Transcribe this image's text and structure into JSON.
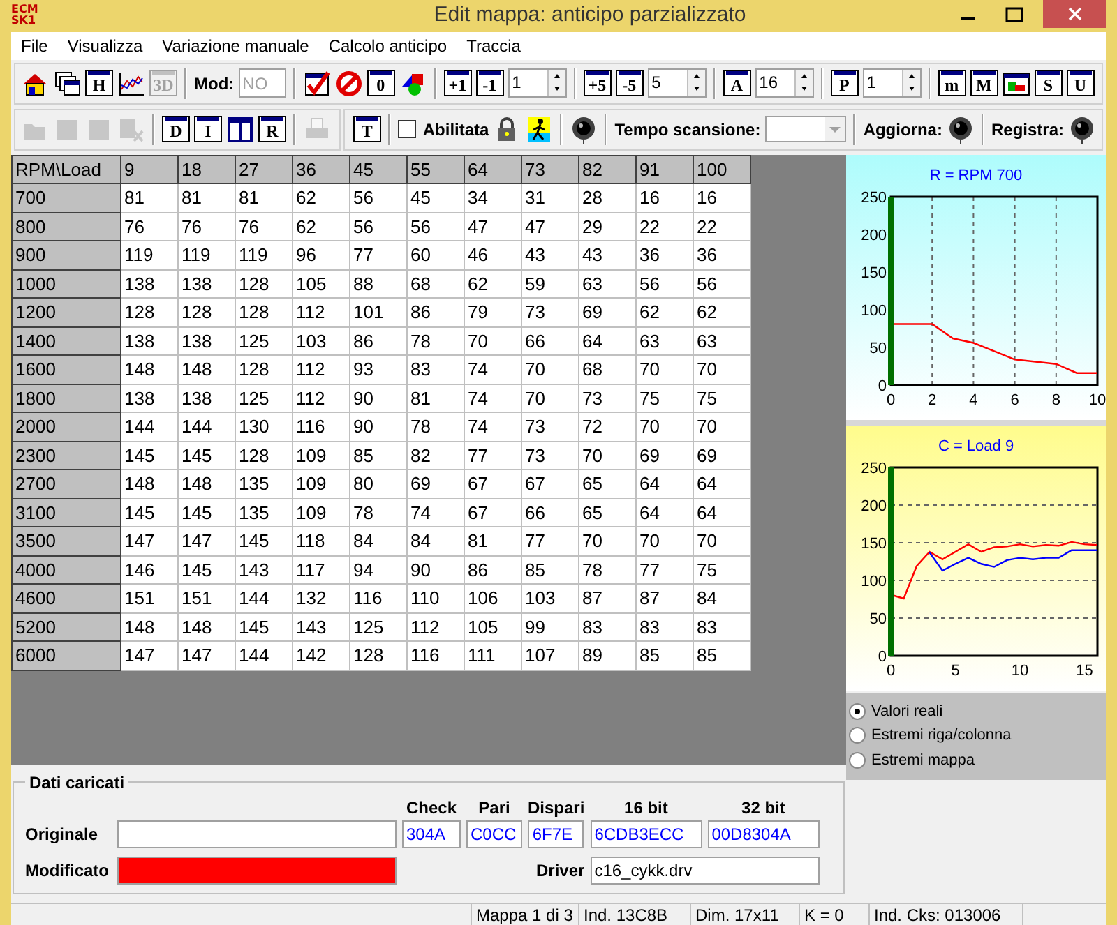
{
  "window": {
    "title": "Edit mappa: anticipo parzializzato",
    "logo": "ECM\nSK1"
  },
  "menu": [
    {
      "label": "File"
    },
    {
      "label": "Visualizza"
    },
    {
      "label": "Variazione manuale"
    },
    {
      "label": "Calcolo anticipo"
    },
    {
      "label": "Traccia"
    }
  ],
  "toolbar1": [
    {
      "kind": "icon",
      "disabled": false
    },
    {
      "kind": "icon",
      "disabled": false
    },
    {
      "kind": "glyph",
      "text": "H",
      "disabled": false
    },
    {
      "kind": "icon",
      "disabled": false
    },
    {
      "kind": "glyph",
      "text": "3D",
      "disabled": true
    },
    {
      "kind": "sep"
    },
    {
      "kind": "label",
      "text": "Mod:"
    },
    {
      "kind": "field",
      "value": "NO",
      "disabled": true
    },
    {
      "kind": "sep"
    },
    {
      "kind": "icon",
      "disabled": false
    },
    {
      "kind": "icon",
      "disabled": false
    },
    {
      "kind": "glyph",
      "text": "0",
      "disabled": false
    },
    {
      "kind": "icon",
      "disabled": false
    },
    {
      "kind": "sep"
    },
    {
      "kind": "glyph",
      "text": "+1",
      "disabled": false
    },
    {
      "kind": "glyph",
      "text": "-1",
      "disabled": false
    },
    {
      "kind": "spin",
      "value": "1"
    },
    {
      "kind": "sep"
    },
    {
      "kind": "glyph",
      "text": "+5",
      "disabled": false
    },
    {
      "kind": "glyph",
      "text": "-5",
      "disabled": false
    },
    {
      "kind": "spin",
      "value": "5"
    },
    {
      "kind": "sep"
    },
    {
      "kind": "glyph",
      "text": "A",
      "disabled": false
    },
    {
      "kind": "spin",
      "value": "16"
    },
    {
      "kind": "sep"
    },
    {
      "kind": "glyph",
      "text": "P",
      "disabled": false
    },
    {
      "kind": "spin",
      "value": "1"
    },
    {
      "kind": "sep"
    },
    {
      "kind": "glyph",
      "text": "m",
      "disabled": false
    },
    {
      "kind": "glyph",
      "text": "M",
      "disabled": false
    },
    {
      "kind": "icon",
      "disabled": false
    },
    {
      "kind": "glyph",
      "text": "S",
      "disabled": false
    },
    {
      "kind": "glyph",
      "text": "U",
      "disabled": false
    }
  ],
  "toolbar2": [
    {
      "kind": "icon",
      "disabled": true
    },
    {
      "kind": "icon",
      "disabled": true
    },
    {
      "kind": "icon",
      "disabled": true
    },
    {
      "kind": "icon",
      "disabled": true
    },
    {
      "kind": "sep"
    },
    {
      "kind": "glyph",
      "text": "D",
      "disabled": false
    },
    {
      "kind": "glyph",
      "text": "I",
      "disabled": false
    },
    {
      "kind": "icon",
      "disabled": false
    },
    {
      "kind": "glyph",
      "text": "R",
      "disabled": false
    },
    {
      "kind": "sep"
    },
    {
      "kind": "icon",
      "disabled": true
    },
    {
      "kind": "gap"
    },
    {
      "kind": "glyph",
      "text": "T",
      "disabled": false
    },
    {
      "kind": "sep"
    },
    {
      "kind": "check",
      "text": "Abilitata",
      "checked": false
    },
    {
      "kind": "icon",
      "disabled": false
    },
    {
      "kind": "icon",
      "disabled": false
    },
    {
      "kind": "sep"
    },
    {
      "kind": "icon",
      "disabled": false
    },
    {
      "kind": "sep"
    },
    {
      "kind": "label",
      "text": "Tempo scansione:"
    },
    {
      "kind": "combo",
      "disabled": true
    },
    {
      "kind": "sep"
    },
    {
      "kind": "label",
      "text": "Aggiorna:"
    },
    {
      "kind": "icon",
      "disabled": false
    },
    {
      "kind": "sep"
    },
    {
      "kind": "label",
      "text": "Registra:"
    },
    {
      "kind": "icon",
      "disabled": false
    }
  ],
  "table": {
    "corner": "RPM\\Load",
    "columns": [
      "9",
      "18",
      "27",
      "36",
      "45",
      "55",
      "64",
      "73",
      "82",
      "91",
      "100"
    ],
    "rows": [
      {
        "rpm": "700",
        "cells": [
          "81",
          "81",
          "81",
          "62",
          "56",
          "45",
          "34",
          "31",
          "28",
          "16",
          "16"
        ]
      },
      {
        "rpm": "800",
        "cells": [
          "76",
          "76",
          "76",
          "62",
          "56",
          "56",
          "47",
          "47",
          "29",
          "22",
          "22"
        ]
      },
      {
        "rpm": "900",
        "cells": [
          "119",
          "119",
          "119",
          "96",
          "77",
          "60",
          "46",
          "43",
          "43",
          "36",
          "36"
        ]
      },
      {
        "rpm": "1000",
        "cells": [
          "138",
          "138",
          "128",
          "105",
          "88",
          "68",
          "62",
          "59",
          "63",
          "56",
          "56"
        ]
      },
      {
        "rpm": "1200",
        "cells": [
          "128",
          "128",
          "128",
          "112",
          "101",
          "86",
          "79",
          "73",
          "69",
          "62",
          "62"
        ]
      },
      {
        "rpm": "1400",
        "cells": [
          "138",
          "138",
          "125",
          "103",
          "86",
          "78",
          "70",
          "66",
          "64",
          "63",
          "63"
        ]
      },
      {
        "rpm": "1600",
        "cells": [
          "148",
          "148",
          "128",
          "112",
          "93",
          "83",
          "74",
          "70",
          "68",
          "70",
          "70"
        ]
      },
      {
        "rpm": "1800",
        "cells": [
          "138",
          "138",
          "125",
          "112",
          "90",
          "81",
          "74",
          "70",
          "73",
          "75",
          "75"
        ]
      },
      {
        "rpm": "2000",
        "cells": [
          "144",
          "144",
          "130",
          "116",
          "90",
          "78",
          "74",
          "73",
          "72",
          "70",
          "70"
        ]
      },
      {
        "rpm": "2300",
        "cells": [
          "145",
          "145",
          "128",
          "109",
          "85",
          "82",
          "77",
          "73",
          "70",
          "69",
          "69"
        ]
      },
      {
        "rpm": "2700",
        "cells": [
          "148",
          "148",
          "135",
          "109",
          "80",
          "69",
          "67",
          "67",
          "65",
          "64",
          "64"
        ]
      },
      {
        "rpm": "3100",
        "cells": [
          "145",
          "145",
          "135",
          "109",
          "78",
          "74",
          "67",
          "66",
          "65",
          "64",
          "64"
        ]
      },
      {
        "rpm": "3500",
        "cells": [
          "147",
          "147",
          "145",
          "118",
          "84",
          "84",
          "81",
          "77",
          "70",
          "70",
          "70"
        ]
      },
      {
        "rpm": "4000",
        "cells": [
          "146",
          "145",
          "143",
          "117",
          "94",
          "90",
          "86",
          "85",
          "78",
          "77",
          "75"
        ]
      },
      {
        "rpm": "4600",
        "cells": [
          "151",
          "151",
          "144",
          "132",
          "116",
          "110",
          "106",
          "103",
          "87",
          "87",
          "84"
        ]
      },
      {
        "rpm": "5200",
        "cells": [
          "148",
          "148",
          "145",
          "143",
          "125",
          "112",
          "105",
          "99",
          "83",
          "83",
          "83"
        ]
      },
      {
        "rpm": "6000",
        "cells": [
          "147",
          "147",
          "144",
          "142",
          "128",
          "116",
          "111",
          "107",
          "89",
          "85",
          "85"
        ]
      }
    ]
  },
  "charts": [
    {
      "chart_data": {
        "type": "line",
        "title": "R = RPM 700",
        "x": [
          0,
          1,
          2,
          3,
          4,
          5,
          6,
          7,
          8,
          9,
          10
        ],
        "series": [
          {
            "color": "#ff0000",
            "values": [
              81,
              81,
              81,
              62,
              56,
              45,
              34,
              31,
              28,
              16,
              16
            ]
          }
        ],
        "xlim": [
          0,
          10
        ],
        "ylim": [
          0,
          250
        ],
        "xticks": [
          0,
          2,
          4,
          6,
          8,
          10
        ],
        "yticks": [
          0,
          50,
          100,
          150,
          200,
          250
        ],
        "grid": "x"
      }
    },
    {
      "chart_data": {
        "type": "line",
        "title": "C = Load 9",
        "x": [
          0,
          1,
          2,
          3,
          4,
          5,
          6,
          7,
          8,
          9,
          10,
          11,
          12,
          13,
          14,
          15,
          16
        ],
        "series": [
          {
            "color": "#ff0000",
            "values": [
              81,
              76,
              119,
              138,
              128,
              138,
              148,
              138,
              144,
              145,
              148,
              145,
              147,
              146,
              151,
              148,
              147
            ]
          },
          {
            "color": "#0000ff",
            "values": [
              null,
              null,
              null,
              137,
              113,
              122,
              130,
              122,
              118,
              127,
              130,
              128,
              130,
              130,
              140,
              140,
              140
            ]
          }
        ],
        "xlim": [
          0,
          16
        ],
        "ylim": [
          0,
          250
        ],
        "xticks": [
          0,
          5,
          10,
          15
        ],
        "yticks": [
          0,
          50,
          100,
          150,
          200,
          250
        ],
        "grid": "y"
      }
    }
  ],
  "view_mode": [
    {
      "label": "Valori reali",
      "selected": true
    },
    {
      "label": "Estremi riga/colonna",
      "selected": false
    },
    {
      "label": "Estremi mappa",
      "selected": false
    }
  ],
  "loaded_data": {
    "legend": "Dati caricati",
    "original_label": "Originale",
    "modified_label": "Modificato",
    "modified": true,
    "columns": [
      {
        "heading": "Check",
        "value": "304A"
      },
      {
        "heading": "Pari",
        "value": "C0CC"
      },
      {
        "heading": "Dispari",
        "value": "6F7E"
      },
      {
        "heading": "16 bit",
        "value": "6CDB3ECC"
      },
      {
        "heading": "32 bit",
        "value": "00D8304A"
      }
    ],
    "driver_label": "Driver",
    "driver": "c16_cykk.drv"
  },
  "status_bar": [
    "Mappa 1 di 3",
    "Ind. 13C8B",
    "Dim. 17x11",
    "K = 0",
    "Ind. Cks: 013006"
  ]
}
